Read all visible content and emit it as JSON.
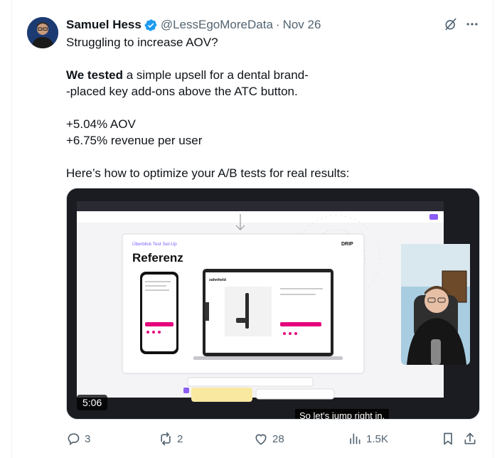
{
  "author": {
    "name": "Samuel Hess",
    "handle": "@LessEgoMoreData",
    "date": "Nov 26",
    "verified": true
  },
  "tweet": {
    "line1": "Struggling to increase AOV?",
    "line2_bold": "We tested",
    "line2_rest": " a simple upsell for a dental brand-",
    "line3": "-placed key add-ons above the ATC button.",
    "line4": "+5.04% AOV",
    "line5": "+6.75% revenue per user",
    "line6": "Here’s how to optimize your A/B tests for real results:"
  },
  "video": {
    "duration": "5:06",
    "caption": "So let's jump right in.",
    "slide_subtitle": "Überblick Test Set-Up",
    "slide_title": "Referenz",
    "slide_logo": "DRIP",
    "laptop_brand": "zahnheld"
  },
  "actions": {
    "replies": "3",
    "reposts": "2",
    "likes": "28",
    "views": "1.5K"
  },
  "colors": {
    "accent": "#1d9bf0",
    "muted": "#536471",
    "pink": "#e4007c"
  },
  "icons": [
    "verified-badge-icon",
    "grok-icon",
    "more-icon",
    "reply-icon",
    "repost-icon",
    "like-icon",
    "views-icon",
    "bookmark-icon",
    "share-icon"
  ]
}
